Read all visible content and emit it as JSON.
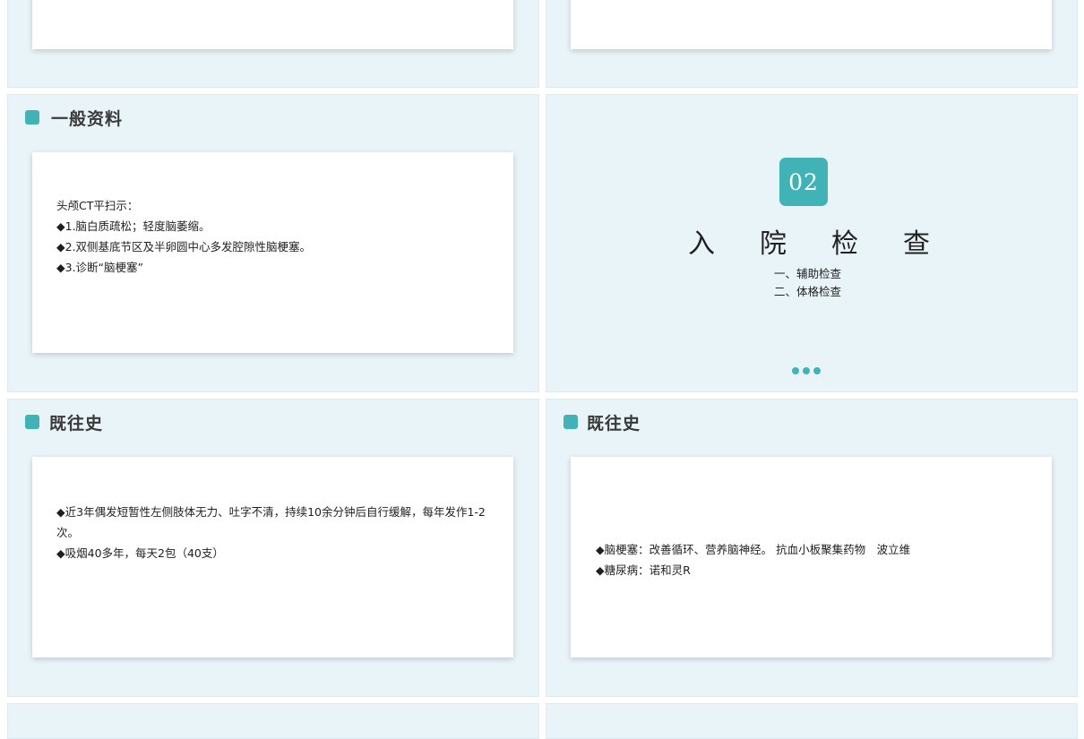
{
  "colors": {
    "accent": "#41b2b6",
    "slide_bg": "#e9f4f9"
  },
  "slide_general": {
    "title": "一般资料",
    "lines": [
      "头颅CT平扫示：",
      "◆1.脑白质疏松；轻度脑萎缩。",
      "◆2.双侧基底节区及半卵圆中心多发腔隙性脑梗塞。",
      "◆3.诊断“脑梗塞”"
    ]
  },
  "slide_section": {
    "number": "02",
    "title": "入院检查",
    "items": [
      "一、辅助检查",
      "二、体格检查"
    ]
  },
  "slide_history_1": {
    "title": "既往史",
    "lines": [
      "◆近3年偶发短暂性左侧肢体无力、吐字不清，持续10余分钟后自行缓解，每年发作1-2",
      "次。",
      "◆吸烟40多年，每天2包（40支）"
    ]
  },
  "slide_history_2": {
    "title": "既往史",
    "lines": [
      "◆脑梗塞：改善循环、营养脑神经。 抗血小板聚集药物　波立维",
      "◆糖尿病：诺和灵R"
    ]
  }
}
